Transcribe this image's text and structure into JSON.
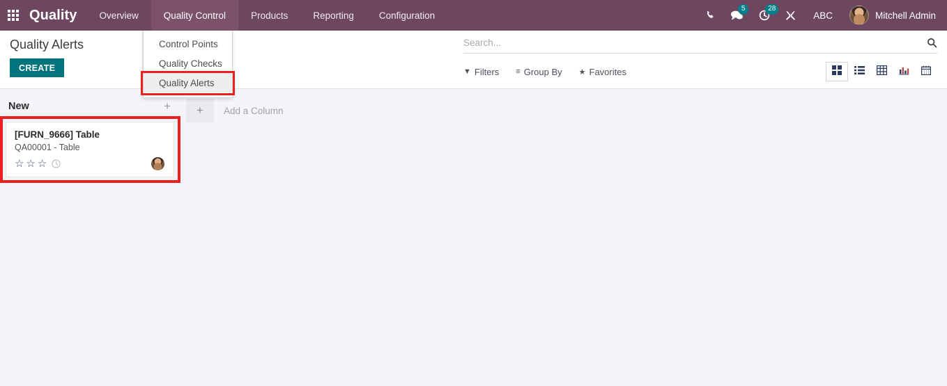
{
  "navbar": {
    "apps_icon": "apps-grid-icon",
    "brand": "Quality",
    "menu": [
      {
        "label": "Overview",
        "active": false
      },
      {
        "label": "Quality Control",
        "active": true
      },
      {
        "label": "Products",
        "active": false
      },
      {
        "label": "Reporting",
        "active": false
      },
      {
        "label": "Configuration",
        "active": false
      }
    ],
    "right": {
      "phone_icon": "phone-icon",
      "messages_icon": "chat-bubble-icon",
      "messages_count": "5",
      "activities_icon": "clock-icon",
      "activities_count": "28",
      "debug_icon": "tools-icon",
      "language": "ABC",
      "user_name": "Mitchell Admin"
    }
  },
  "dropdown": {
    "items": [
      {
        "label": "Control Points",
        "highlighted": false
      },
      {
        "label": "Quality Checks",
        "highlighted": false
      },
      {
        "label": "Quality Alerts",
        "highlighted": true
      }
    ]
  },
  "control_panel": {
    "title": "Quality Alerts",
    "create_label": "CREATE",
    "search": {
      "value": "",
      "placeholder": "Search..."
    },
    "search_icon": "search-icon",
    "filters": [
      {
        "label": "Filters",
        "icon": "filter-icon"
      },
      {
        "label": "Group By",
        "icon": "group-by-icon"
      },
      {
        "label": "Favorites",
        "icon": "star-icon"
      }
    ],
    "views": [
      {
        "name": "kanban-view",
        "icon": "kanban-icon",
        "active": true
      },
      {
        "name": "list-view",
        "icon": "list-icon",
        "active": false
      },
      {
        "name": "pivot-view",
        "icon": "pivot-icon",
        "active": false
      },
      {
        "name": "graph-view",
        "icon": "bar-chart-icon",
        "active": false
      },
      {
        "name": "calendar-view",
        "icon": "calendar-icon",
        "active": false
      }
    ]
  },
  "kanban": {
    "column": {
      "title": "New",
      "add_icon": "plus-icon"
    },
    "card": {
      "title": "[FURN_9666] Table",
      "subtitle": "QA00001 - Table",
      "stars": [
        "☆",
        "☆",
        "☆"
      ],
      "clock_icon": "clock-icon",
      "avatar": "user-avatar"
    },
    "add_column": {
      "plus": "+",
      "label": "Add a Column"
    }
  },
  "colors": {
    "navbar": "#6d4760",
    "navbar_active": "#7b5269",
    "accent_teal": "#00747d",
    "badge_teal": "#00808a",
    "highlight_red": "#ee1f1f",
    "background": "#f4f5f9"
  }
}
